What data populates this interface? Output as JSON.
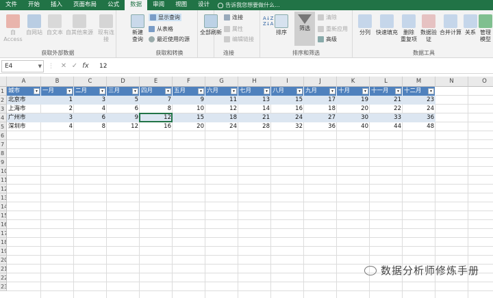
{
  "tabs": [
    "文件",
    "开始",
    "插入",
    "页面布局",
    "公式",
    "数据",
    "审阅",
    "视图",
    "设计"
  ],
  "active_tab": "数据",
  "tell_me": "告诉我您想要做什么...",
  "ribbon": {
    "get_external": {
      "label": "获取外部数据",
      "buttons": [
        "自 Access",
        "自网站",
        "自文本",
        "自其他来源",
        "现有连接"
      ]
    },
    "get_transform": {
      "label": "获取和转换",
      "new_query": "新建\n查询",
      "items": [
        "显示查询",
        "从表格",
        "最近使用的源"
      ]
    },
    "connections": {
      "label": "连接",
      "refresh_all": "全部刷新",
      "items": [
        "连接",
        "属性",
        "编辑链接"
      ]
    },
    "sort_filter": {
      "label": "排序和筛选",
      "sort": "排序",
      "filter": "筛选",
      "items": [
        "清除",
        "重新应用",
        "高级"
      ]
    },
    "data_tools": {
      "label": "数据工具",
      "buttons": [
        "分列",
        "快速填充",
        "删除\n重复项",
        "数据验\n证",
        "合并计算",
        "关系",
        "管理\n模型"
      ]
    }
  },
  "formula_bar": {
    "name_box": "E4",
    "fx": "fx",
    "value": "12"
  },
  "grid": {
    "columns": [
      "A",
      "B",
      "C",
      "D",
      "E",
      "F",
      "G",
      "H",
      "I",
      "J",
      "K",
      "L",
      "M",
      "N",
      "O"
    ],
    "row_count": 23,
    "headers": [
      "城市",
      "一月",
      "二月",
      "三月",
      "四月",
      "五月",
      "六月",
      "七月",
      "八月",
      "九月",
      "十月",
      "十一月",
      "十二月"
    ],
    "rows": [
      {
        "city": "北京市",
        "values": [
          1,
          3,
          5,
          7,
          9,
          11,
          13,
          15,
          17,
          19,
          21,
          23
        ]
      },
      {
        "city": "上海市",
        "values": [
          2,
          4,
          6,
          8,
          10,
          12,
          14,
          16,
          18,
          20,
          22,
          24
        ]
      },
      {
        "city": "广州市",
        "values": [
          3,
          6,
          9,
          12,
          15,
          18,
          21,
          24,
          27,
          30,
          33,
          36
        ]
      },
      {
        "city": "深圳市",
        "values": [
          4,
          8,
          12,
          16,
          20,
          24,
          28,
          32,
          36,
          40,
          44,
          48
        ]
      }
    ]
  },
  "watermark": "数据分析师修炼手册",
  "colors": {
    "accent": "#217346",
    "table_header": "#4f81bd",
    "table_band": "#dce6f1"
  }
}
